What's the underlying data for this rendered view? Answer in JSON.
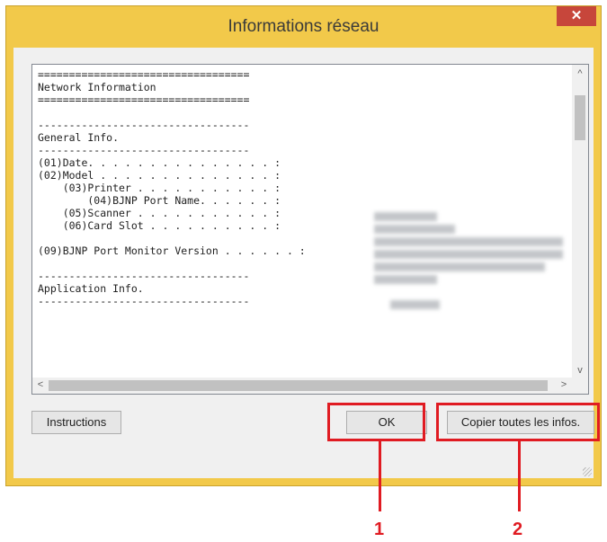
{
  "window": {
    "title": "Informations réseau",
    "close_glyph": "✕"
  },
  "info_text": "==================================\nNetwork Information\n==================================\n\n----------------------------------\nGeneral Info.\n----------------------------------\n(01)Date. . . . . . . . . . . . . . . :\n(02)Model . . . . . . . . . . . . . . :\n    (03)Printer . . . . . . . . . . . :\n        (04)BJNP Port Name. . . . . . :\n    (05)Scanner . . . . . . . . . . . :\n    (06)Card Slot . . . . . . . . . . :\n\n(09)BJNP Port Monitor Version . . . . . . :\n\n----------------------------------\nApplication Info.\n----------------------------------",
  "scrollbar": {
    "up_arrow": "^",
    "down_arrow": "v",
    "left_arrow": "<",
    "right_arrow": ">"
  },
  "buttons": {
    "instructions": "Instructions",
    "ok": "OK",
    "copy_all": "Copier toutes les infos."
  },
  "callouts": [
    "1",
    "2"
  ],
  "colors": {
    "frame": "#f2c94a",
    "close": "#c7463b",
    "highlight": "#e01b22"
  }
}
